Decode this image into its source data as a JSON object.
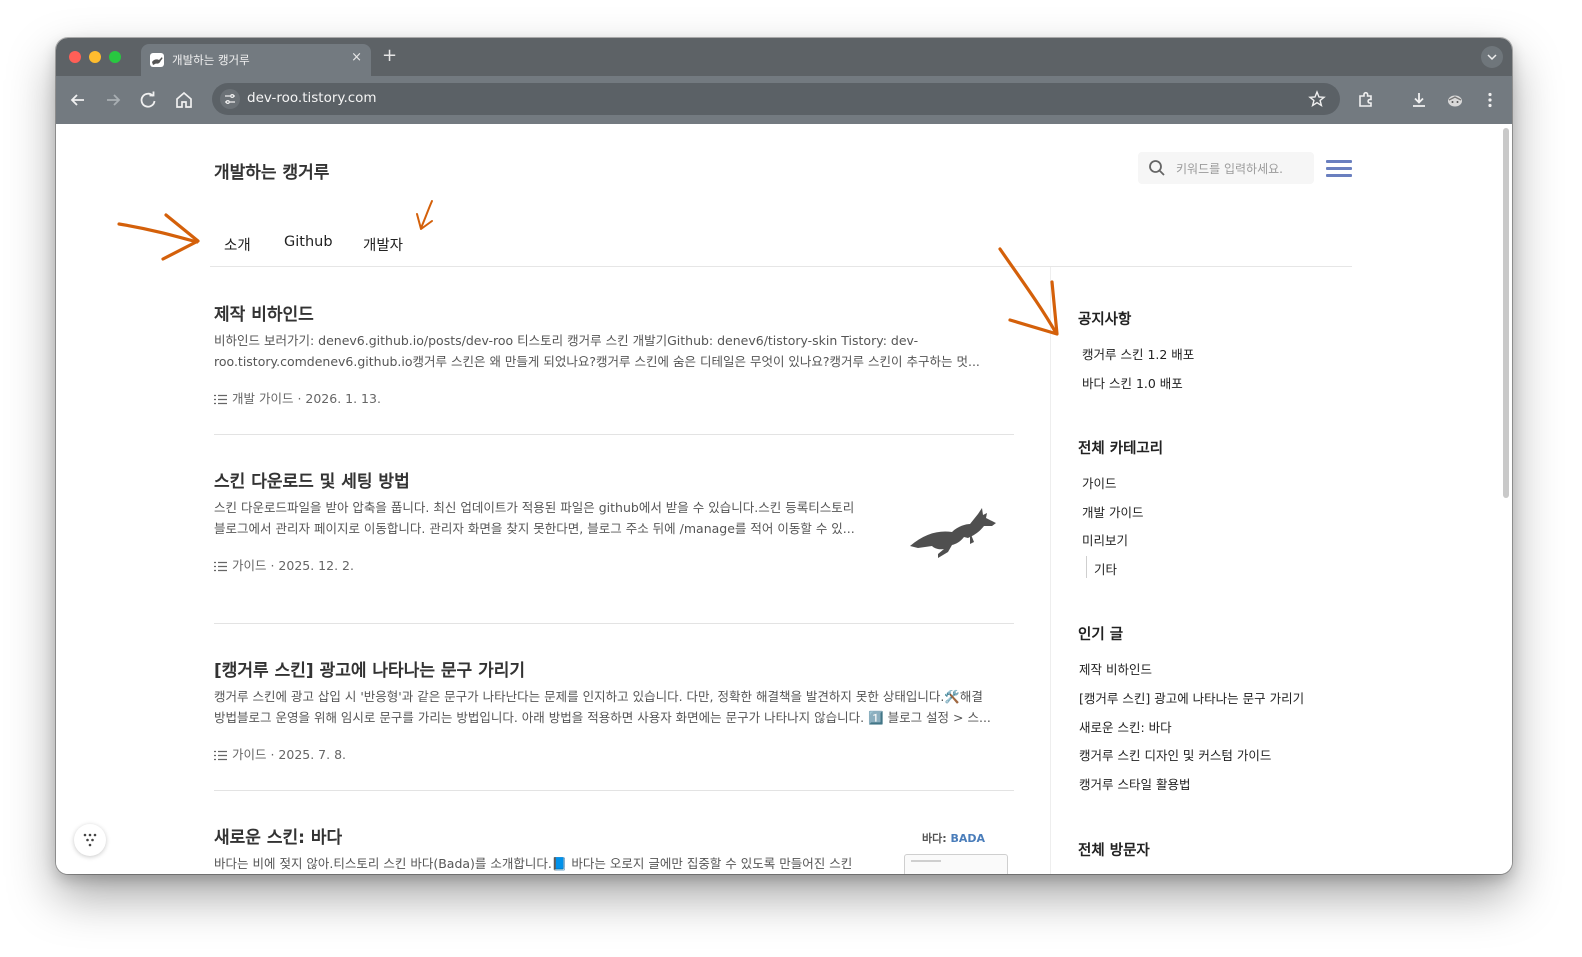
{
  "browser": {
    "tab_title": "개발하는 캥거루",
    "tab_close": "×",
    "new_tab": "+",
    "url": "dev-roo.tistory.com"
  },
  "blog": {
    "title": "개발하는 캥거루",
    "search_placeholder": "키워드를 입력하세요."
  },
  "nav": {
    "items": [
      {
        "label": "소개"
      },
      {
        "label": "Github"
      },
      {
        "label": "개발자"
      }
    ]
  },
  "posts": [
    {
      "title": "제작 비하인드",
      "excerpt_line1": "비하인드 보러가기: denev6.github.io/posts/dev-roo 티스토리 캥거루 스킨 개발기Github: denev6/tistory-skin Tistory: dev-",
      "excerpt_line2": "roo.tistory.comdenev6.github.io캥거루 스킨은 왜 만들게 되었나요?캥거루 스킨에 숨은 디테일은 무엇이 있나요?캥거루 스킨이 추구하는 멋...",
      "meta": "개발 가이드 · 2026. 1. 13."
    },
    {
      "title": "스킨 다운로드 및 세팅 방법",
      "excerpt_line1": "스킨 다운로드파일을 받아 압축을 풉니다. 최신 업데이트가 적용된 파일은 github에서 받을 수 있습니다.스킨 등록티스토리",
      "excerpt_line2": "블로그에서 관리자 페이지로 이동합니다. 관리자 화면을 찾지 못한다면, 블로그 주소 뒤에 /manage를 적어 이동할 수 있...",
      "meta": "가이드 · 2025. 12. 2."
    },
    {
      "title": "[캥거루 스킨] 광고에 나타나는 문구 가리기",
      "excerpt_line1": "캥거루 스킨에 광고 삽입 시 '반응형'과 같은 문구가 나타난다는 문제를 인지하고 있습니다. 다만, 정확한 해결책을 발견하지 못한 상태입니다.🛠️해결",
      "excerpt_line2": "방법블로그 운영을 위해 임시로 문구를 가리는 방법입니다. 아래 방법을 적용하면 사용자 화면에는 문구가 나타나지 않습니다. 1️⃣ 블로그 설정 > 스...",
      "meta": "가이드 · 2025. 7. 8."
    },
    {
      "title": "새로운 스킨: 바다",
      "excerpt_line1": "바다는 비에 젖지 않아.티스토리 스킨 바다(Bada)를 소개합니다.📘 바다는 오로지 글에만 집중할 수 있도록 만들어진 스킨",
      "excerpt_line2": "",
      "meta": ""
    }
  ],
  "bada_thumb": {
    "label": "바다: ",
    "accent": "BADA"
  },
  "sidebar": {
    "notice": {
      "heading": "공지사항",
      "items": [
        {
          "label": "캥거루 스킨 1.2 배포"
        },
        {
          "label": "바다 스킨 1.0 배포"
        }
      ]
    },
    "categories": {
      "heading": "전체 카테고리",
      "items": [
        {
          "label": "가이드"
        },
        {
          "label": "개발 가이드"
        },
        {
          "label": "미리보기"
        },
        {
          "label": "기타"
        }
      ]
    },
    "popular": {
      "heading": "인기 글",
      "items": [
        {
          "label": "제작 비하인드"
        },
        {
          "label": "[캥거루 스킨] 광고에 나타나는 문구 가리기"
        },
        {
          "label": "새로운 스킨: 바다"
        },
        {
          "label": "캥거루 스킨 디자인 및 커스텀 가이드"
        },
        {
          "label": "캥거루 스타일 활용법"
        }
      ]
    },
    "visitors": {
      "heading": "전체 방문자"
    }
  },
  "colors": {
    "annotation_arrow": "#d4600a",
    "menu_accent": "#6a7fbf"
  }
}
